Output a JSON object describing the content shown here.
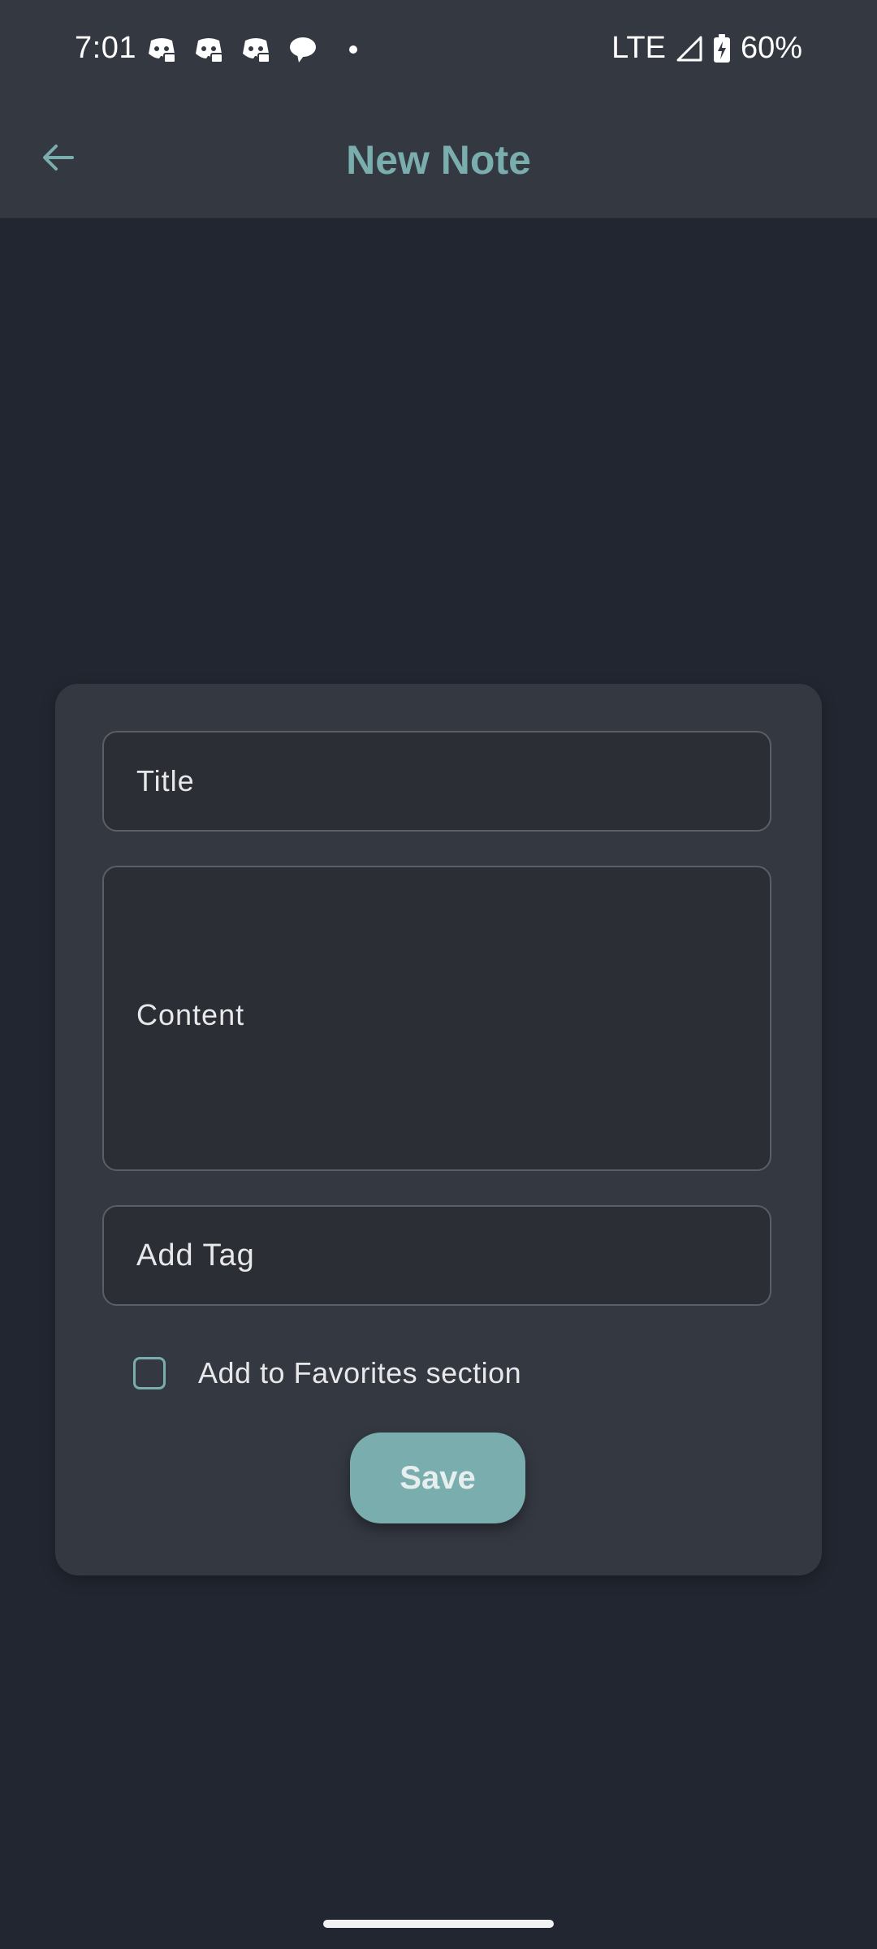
{
  "status_bar": {
    "time": "7:01",
    "network": "LTE",
    "battery": "60%",
    "icons": [
      "discord-icon",
      "discord-icon",
      "discord-icon",
      "chat-bubble-icon",
      "notification-dot-icon",
      "signal-icon",
      "battery-charging-icon"
    ]
  },
  "app_bar": {
    "title": "New Note",
    "back_icon": "arrow-back-icon"
  },
  "form": {
    "title_placeholder": "Title",
    "content_placeholder": "Content",
    "tag_placeholder": "Add Tag",
    "favorites_label": "Add to Favorites section",
    "favorites_checked": false,
    "save_label": "Save"
  },
  "colors": {
    "background": "#212630",
    "bar": "#343841",
    "card": "#343841",
    "accent": "#7aadad",
    "field": "#2b2e35"
  }
}
